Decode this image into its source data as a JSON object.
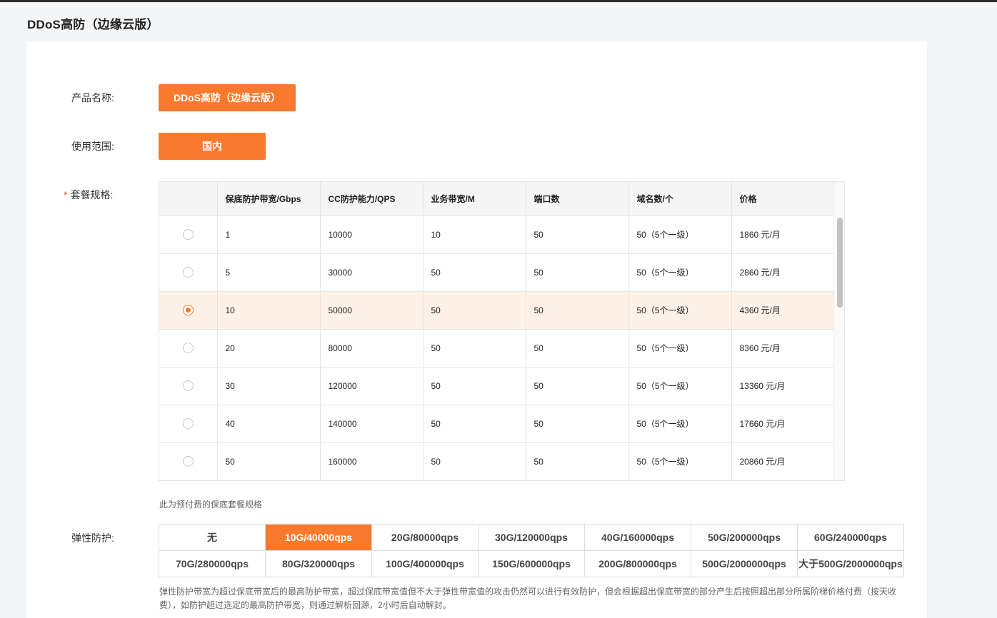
{
  "page": {
    "title": "DDoS高防（边缘云版）"
  },
  "form": {
    "product_label": "产品名称:",
    "product_value": "DDoS高防（边缘云版）",
    "scope_label": "使用范围:",
    "scope_value": "国内",
    "package_label": "套餐规格:",
    "required_mark": "*",
    "elastic_label": "弹性防护:"
  },
  "table": {
    "headers": [
      "",
      "保底防护带宽/Gbps",
      "CC防护能力/QPS",
      "业务带宽/M",
      "端口数",
      "域名数/个",
      "价格"
    ],
    "rows": [
      {
        "bandwidth": "1",
        "qps": "10000",
        "biz": "10",
        "ports": "50",
        "domains": "50（5个一级）",
        "price": "1860 元/月",
        "selected": false
      },
      {
        "bandwidth": "5",
        "qps": "30000",
        "biz": "50",
        "ports": "50",
        "domains": "50（5个一级）",
        "price": "2860 元/月",
        "selected": false
      },
      {
        "bandwidth": "10",
        "qps": "50000",
        "biz": "50",
        "ports": "50",
        "domains": "50（5个一级）",
        "price": "4360 元/月",
        "selected": true
      },
      {
        "bandwidth": "20",
        "qps": "80000",
        "biz": "50",
        "ports": "50",
        "domains": "50（5个一级）",
        "price": "8360 元/月",
        "selected": false
      },
      {
        "bandwidth": "30",
        "qps": "120000",
        "biz": "50",
        "ports": "50",
        "domains": "50（5个一级）",
        "price": "13360 元/月",
        "selected": false
      },
      {
        "bandwidth": "40",
        "qps": "140000",
        "biz": "50",
        "ports": "50",
        "domains": "50（5个一级）",
        "price": "17660 元/月",
        "selected": false
      },
      {
        "bandwidth": "50",
        "qps": "160000",
        "biz": "50",
        "ports": "50",
        "domains": "50（5个一级）",
        "price": "20860 元/月",
        "selected": false
      }
    ],
    "hint": "此为预付费的保底套餐规格"
  },
  "elastic": {
    "options": [
      "无",
      "10G/40000qps",
      "20G/80000qps",
      "30G/120000qps",
      "40G/160000qps",
      "50G/200000qps",
      "60G/240000qps",
      "70G/280000qps",
      "80G/320000qps",
      "100G/400000qps",
      "150G/600000qps",
      "200G/800000qps",
      "500G/2000000qps",
      "大于500G/2000000qps"
    ],
    "selected_index": 1,
    "description": "弹性防护带宽为超过保底带宽后的最高防护带宽，超过保底带宽值但不大于弹性带宽值的攻击仍然可以进行有效防护，但会根据超出保底带宽的部分产生后按照超出部分所属阶梯价格付费（按天收费），如防护超过选定的最高防护带宽，则通过解析回源，2小时后自动解封。"
  },
  "colors": {
    "accent": "#f97a2d",
    "selected_row": "#fef1e8"
  }
}
